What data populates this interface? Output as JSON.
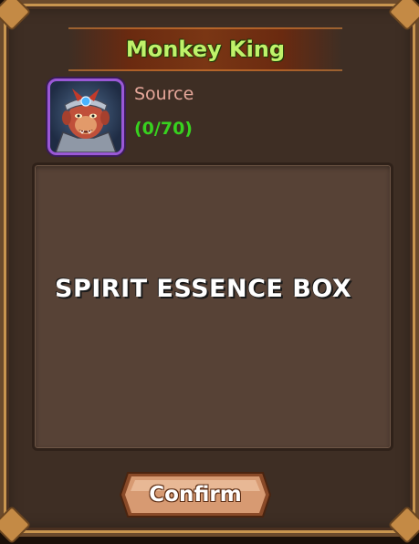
{
  "dialog": {
    "title": "Monkey King",
    "source_label": "Source",
    "progress_text": "(0/70)",
    "description": "SPIRIT ESSENCE BOX",
    "confirm_label": "Confirm"
  },
  "icons": {
    "portrait": "monkey-king-portrait"
  },
  "colors": {
    "title": "#bff26a",
    "progress": "#38d11f",
    "source": "#e6a79a",
    "portrait_border": "#9a58d6"
  }
}
